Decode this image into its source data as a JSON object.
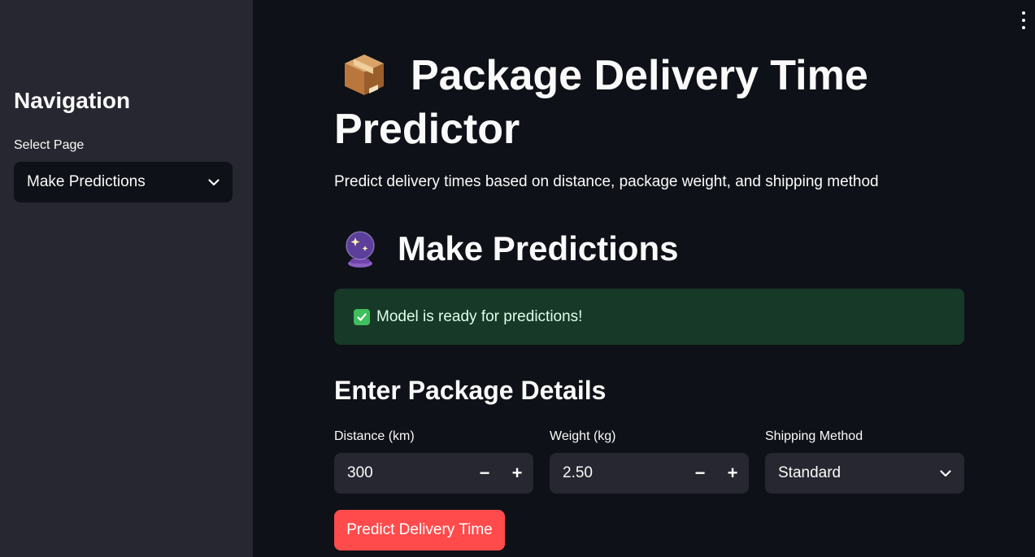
{
  "sidebar": {
    "title": "Navigation",
    "select_label": "Select Page",
    "select_value": "Make Predictions"
  },
  "main": {
    "title": "Package Delivery Time Predictor",
    "subtitle": "Predict delivery times based on distance, package weight, and shipping method",
    "section_title": "Make Predictions",
    "success_message": "Model is ready for predictions!",
    "form_title": "Enter Package Details",
    "distance": {
      "label": "Distance (km)",
      "value": "300"
    },
    "weight": {
      "label": "Weight (kg)",
      "value": "2.50"
    },
    "shipping": {
      "label": "Shipping Method",
      "value": "Standard"
    },
    "predict_button": "Predict Delivery Time",
    "minus": "−",
    "plus": "+"
  },
  "colors": {
    "background": "#0e1117",
    "sidebar": "#262730",
    "success_bg": "#173928",
    "primary": "#ff4b4b"
  },
  "icons": [
    "package-icon",
    "crystal-ball-icon",
    "check-icon",
    "chevron-down-icon",
    "more-vert-icon"
  ]
}
